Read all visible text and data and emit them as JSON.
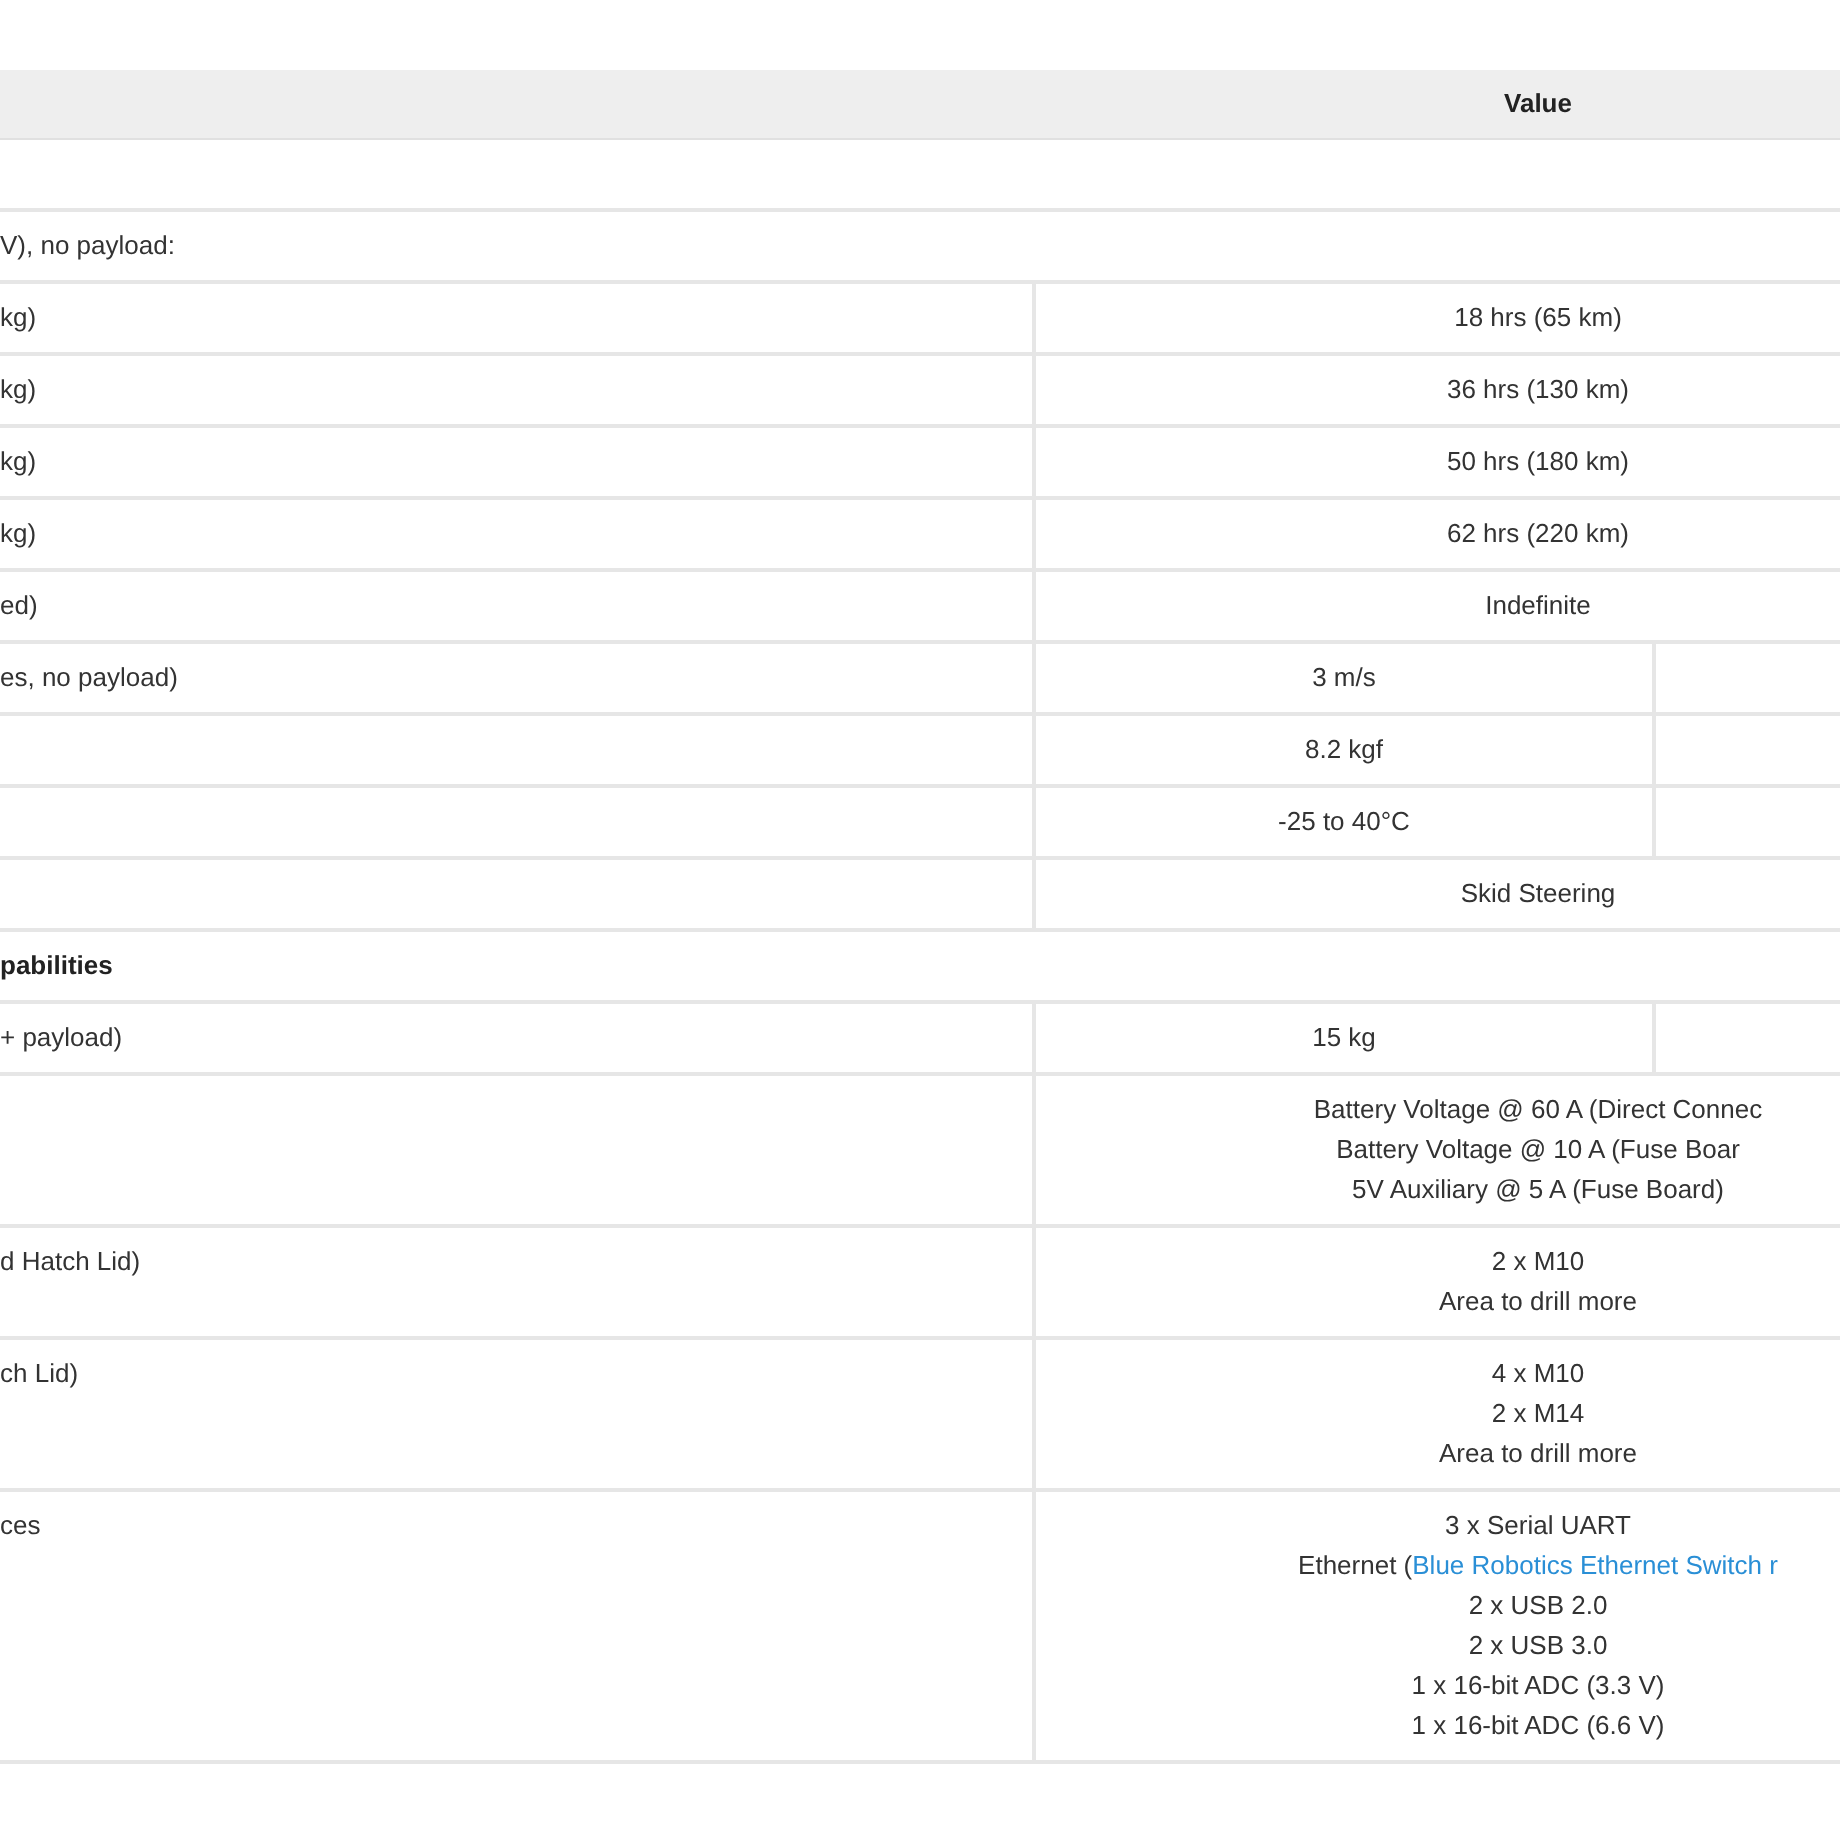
{
  "table": {
    "header": {
      "value": "Value"
    },
    "rows": [
      {
        "kind": "blank"
      },
      {
        "kind": "note",
        "label": "V), no payload:"
      },
      {
        "kind": "single",
        "label": "kg)",
        "value": [
          "18 hrs (65 km)"
        ]
      },
      {
        "kind": "single",
        "label": "kg)",
        "value": [
          "36 hrs (130 km)"
        ]
      },
      {
        "kind": "single",
        "label": "kg)",
        "value": [
          "50 hrs (180 km)"
        ]
      },
      {
        "kind": "single",
        "label": "kg)",
        "value": [
          "62 hrs (220 km)"
        ]
      },
      {
        "kind": "single",
        "label": "ed)",
        "value": [
          "Indefinite"
        ]
      },
      {
        "kind": "split",
        "label": "es, no payload)",
        "value": [
          "3 m/s"
        ]
      },
      {
        "kind": "split",
        "value": [
          "8.2 kgf"
        ]
      },
      {
        "kind": "split",
        "value": [
          "-25 to 40°C"
        ]
      },
      {
        "kind": "single",
        "value": [
          "Skid Steering"
        ]
      },
      {
        "kind": "section",
        "label": "pabilities"
      },
      {
        "kind": "split",
        "label": "+ payload)",
        "value": [
          "15 kg"
        ]
      },
      {
        "kind": "single",
        "value": [
          "Battery Voltage @ 60 A (Direct Connec",
          "Battery Voltage @ 10 A (Fuse Boar",
          "5V Auxiliary @ 5 A (Fuse Board)"
        ]
      },
      {
        "kind": "single",
        "label": "d Hatch Lid)",
        "value": [
          "2 x M10",
          "Area to drill more"
        ]
      },
      {
        "kind": "single",
        "label": "ch Lid)",
        "value": [
          "4 x M10",
          "2 x M14",
          "Area to drill more"
        ]
      },
      {
        "kind": "single",
        "label": "ces",
        "value": [
          "3 x Serial UART",
          {
            "text": "Ethernet (",
            "link": "Blue Robotics Ethernet Switch r"
          },
          "2 x USB 2.0",
          "2 x USB 3.0",
          "1 x 16-bit ADC (3.3 V)",
          "1 x 16-bit ADC (6.6 V)"
        ]
      }
    ]
  }
}
